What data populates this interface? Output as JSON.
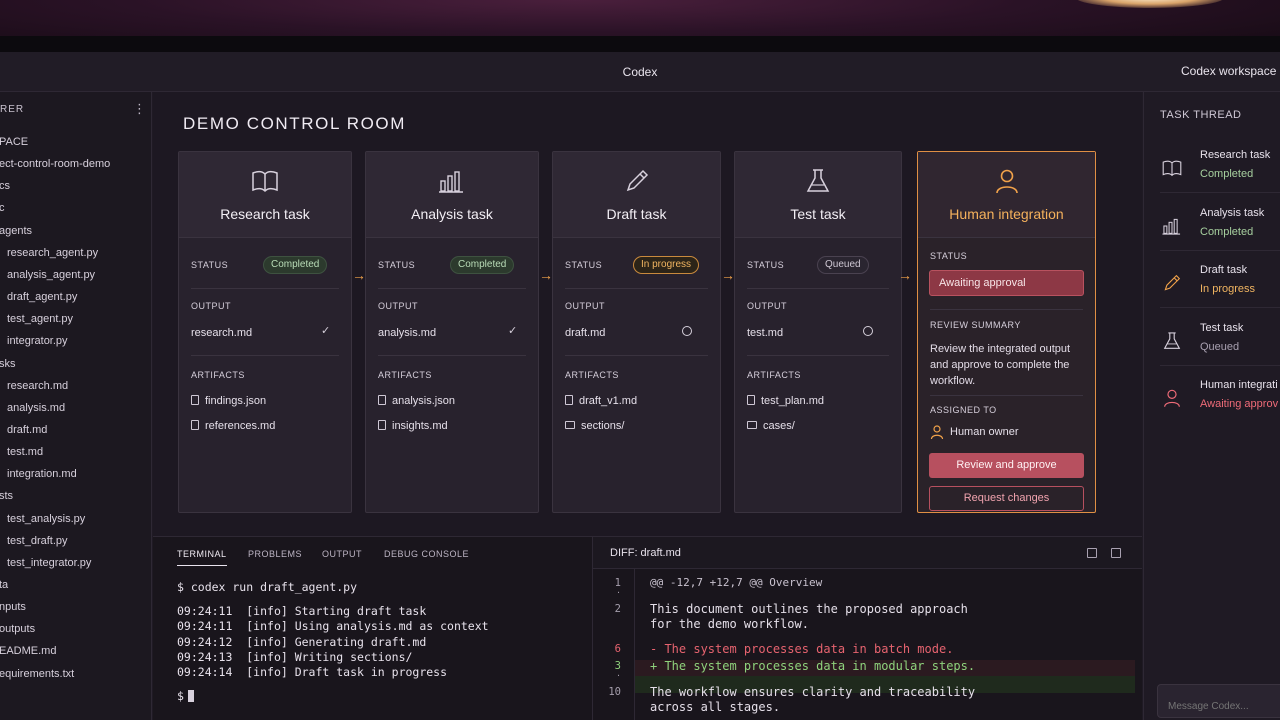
{
  "window": {
    "title": "Codex",
    "workspace": "Codex workspace"
  },
  "explorer": {
    "header": "RER",
    "more_icon": "more-vertical-icon",
    "items": [
      {
        "label": "PACE",
        "indent": 0
      },
      {
        "label": "ect-control-room-demo",
        "indent": 0
      },
      {
        "label": "cs",
        "indent": 0
      },
      {
        "label": "c",
        "indent": 0
      },
      {
        "label": "agents",
        "indent": 0
      },
      {
        "label": "research_agent.py",
        "indent": 1
      },
      {
        "label": "analysis_agent.py",
        "indent": 1
      },
      {
        "label": "draft_agent.py",
        "indent": 1
      },
      {
        "label": "test_agent.py",
        "indent": 1
      },
      {
        "label": "integrator.py",
        "indent": 1
      },
      {
        "label": "sks",
        "indent": 0
      },
      {
        "label": "research.md",
        "indent": 1
      },
      {
        "label": "analysis.md",
        "indent": 1
      },
      {
        "label": "draft.md",
        "indent": 1
      },
      {
        "label": "test.md",
        "indent": 1
      },
      {
        "label": "integration.md",
        "indent": 1
      },
      {
        "label": "sts",
        "indent": 0
      },
      {
        "label": "test_analysis.py",
        "indent": 1
      },
      {
        "label": "test_draft.py",
        "indent": 1
      },
      {
        "label": "test_integrator.py",
        "indent": 1
      },
      {
        "label": "ta",
        "indent": 0
      },
      {
        "label": "nputs",
        "indent": 0
      },
      {
        "label": "outputs",
        "indent": 0
      },
      {
        "label": "EADME.md",
        "indent": 0
      },
      {
        "label": "equirements.txt",
        "indent": 0
      }
    ]
  },
  "control_room": {
    "title": "DEMO CONTROL ROOM",
    "labels": {
      "status": "STATUS",
      "output": "OUTPUT",
      "artifacts": "ARTIFACTS"
    },
    "cards": [
      {
        "title": "Research task",
        "icon": "book-icon",
        "status": "Completed",
        "status_kind": "done",
        "output": "research.md",
        "output_mark": "check",
        "artifacts": [
          "findings.json",
          "references.md"
        ],
        "artifact_kinds": [
          "file",
          "file"
        ]
      },
      {
        "title": "Analysis task",
        "icon": "bar-chart-icon",
        "status": "Completed",
        "status_kind": "done",
        "output": "analysis.md",
        "output_mark": "check",
        "artifacts": [
          "analysis.json",
          "insights.md"
        ],
        "artifact_kinds": [
          "file",
          "file"
        ]
      },
      {
        "title": "Draft task",
        "icon": "pencil-icon",
        "status": "In progress",
        "status_kind": "prog",
        "output": "draft.md",
        "output_mark": "circle",
        "artifacts": [
          "draft_v1.md",
          "sections/"
        ],
        "artifact_kinds": [
          "file",
          "folder"
        ]
      },
      {
        "title": "Test task",
        "icon": "flask-icon",
        "status": "Queued",
        "status_kind": "queue",
        "output": "test.md",
        "output_mark": "circle",
        "artifacts": [
          "test_plan.md",
          "cases/"
        ],
        "artifact_kinds": [
          "file",
          "folder"
        ]
      }
    ],
    "human": {
      "title": "Human integration",
      "icon": "user-icon",
      "status_label": "STATUS",
      "status": "Awaiting approval",
      "review_label": "REVIEW SUMMARY",
      "review_text": "Review the integrated output and approve to complete the workflow.",
      "assigned_label": "ASSIGNED TO",
      "assignee": "Human owner",
      "approve_button": "Review and approve",
      "changes_button": "Request changes"
    },
    "accent": "#f1a24a"
  },
  "terminal": {
    "tabs": [
      "TERMINAL",
      "PROBLEMS",
      "OUTPUT",
      "DEBUG CONSOLE"
    ],
    "active_tab": "TERMINAL",
    "command": "$ codex run draft_agent.py",
    "lines": [
      {
        "time": "09:24:11",
        "text": "[info] Starting draft task"
      },
      {
        "time": "09:24:11",
        "text": "[info] Using analysis.md as context"
      },
      {
        "time": "09:24:12",
        "text": "[info] Generating draft.md"
      },
      {
        "time": "09:24:13",
        "text": "[info] Writing sections/"
      },
      {
        "time": "09:24:14",
        "text": "[info] Draft task in progress"
      }
    ],
    "prompt": "$"
  },
  "diff": {
    "title": "DIFF: draft.md",
    "lines": [
      {
        "num": "1",
        "text": "@@ -12,7 +12,7 @@ Overview",
        "kind": "hunk"
      },
      {
        "num": "",
        "text": "",
        "kind": "blank"
      },
      {
        "num": "2",
        "text": "This document outlines the proposed approach",
        "kind": "ctx"
      },
      {
        "num": "",
        "text": "for the demo workflow.",
        "kind": "ctx"
      },
      {
        "num": "6",
        "text": "- The system processes data in batch mode.",
        "kind": "removed"
      },
      {
        "num": "3",
        "text": "+ The system processes data in modular steps.",
        "kind": "added"
      },
      {
        "num": "",
        "text": "",
        "kind": "blank"
      },
      {
        "num": "10",
        "text": "The workflow ensures clarity and traceability",
        "kind": "ctx"
      },
      {
        "num": "",
        "text": "across all stages.",
        "kind": "ctx"
      }
    ]
  },
  "thread": {
    "header": "TASK THREAD",
    "items": [
      {
        "title": "Research task",
        "status": "Completed",
        "kind": "ok",
        "icon": "book-icon"
      },
      {
        "title": "Analysis task",
        "status": "Completed",
        "kind": "ok",
        "icon": "bar-chart-icon"
      },
      {
        "title": "Draft task",
        "status": "In progress",
        "kind": "prog",
        "icon": "pencil-icon"
      },
      {
        "title": "Test task",
        "status": "Queued",
        "kind": "q",
        "icon": "flask-icon"
      },
      {
        "title": "Human integrati",
        "status": "Awaiting approv",
        "kind": "await",
        "icon": "user-icon"
      }
    ],
    "message_placeholder": "Message Codex..."
  }
}
